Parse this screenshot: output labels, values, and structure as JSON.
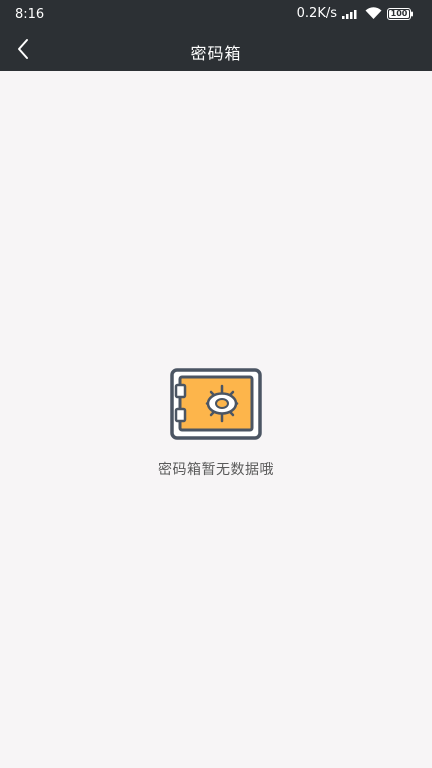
{
  "status_bar": {
    "time": "8:16",
    "network_speed": "0.2K/s",
    "battery": "100",
    "icons": [
      "signal-icon",
      "wifi-icon",
      "battery-icon"
    ]
  },
  "header": {
    "title": "密码箱",
    "back_icon": "chevron-left-icon"
  },
  "empty_state": {
    "icon": "safe-icon",
    "message": "密码箱暂无数据哦"
  },
  "colors": {
    "header_bg": "#2c3034",
    "page_bg": "#f7f5f6",
    "safe_outline": "#4b5563",
    "safe_fill": "#fdb54b"
  }
}
